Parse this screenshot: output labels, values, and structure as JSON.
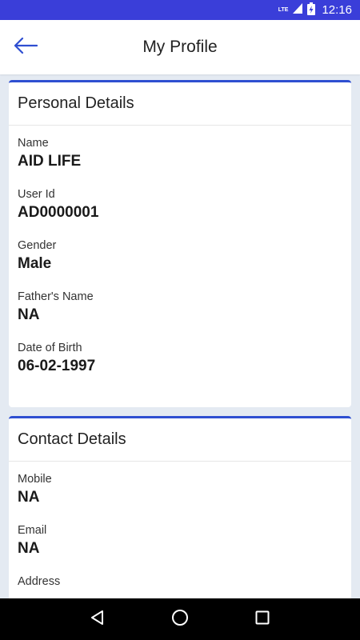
{
  "status_bar": {
    "network_label": "LTE",
    "time": "12:16"
  },
  "app_bar": {
    "title": "My Profile"
  },
  "personal": {
    "header": "Personal Details",
    "fields": [
      {
        "label": "Name",
        "value": "AID LIFE"
      },
      {
        "label": "User Id",
        "value": "AD0000001"
      },
      {
        "label": "Gender",
        "value": "Male"
      },
      {
        "label": "Father's Name",
        "value": "NA"
      },
      {
        "label": "Date of Birth",
        "value": "06-02-1997"
      }
    ]
  },
  "contact": {
    "header": "Contact Details",
    "fields": [
      {
        "label": "Mobile",
        "value": "NA"
      },
      {
        "label": "Email",
        "value": "NA"
      },
      {
        "label": "Address",
        "value": ""
      }
    ]
  },
  "colors": {
    "status_bar": "#3a3ed9",
    "accent": "#2f4fd1",
    "background": "#e4eaf2"
  }
}
